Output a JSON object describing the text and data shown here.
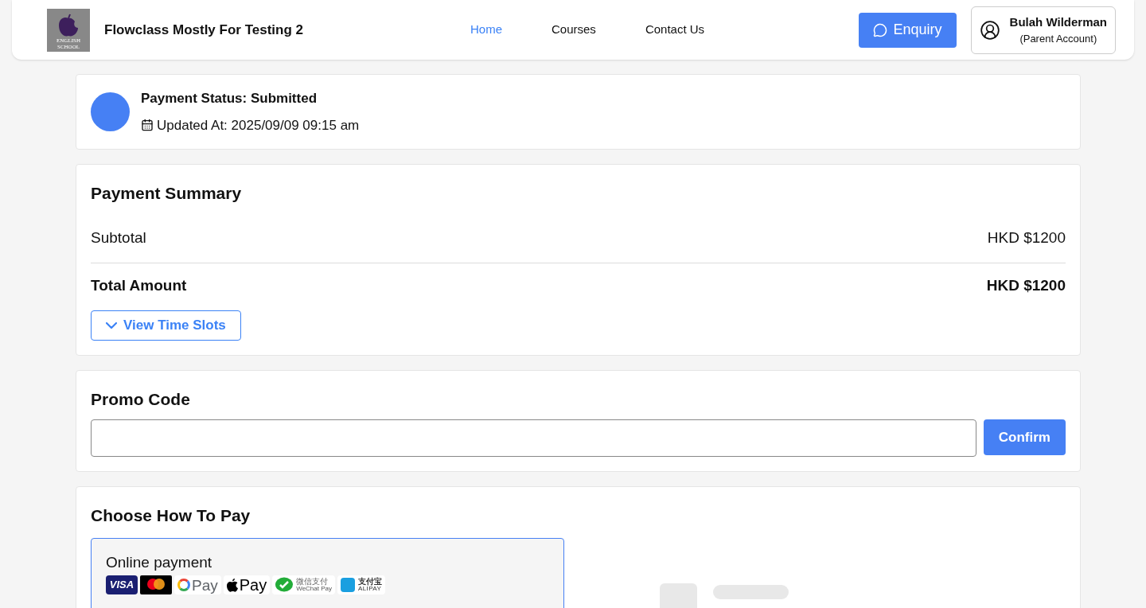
{
  "header": {
    "logo_lines": [
      "ENGLISH",
      "SCHOOL"
    ],
    "site_title": "Flowclass Mostly For Testing 2",
    "nav": [
      {
        "label": "Home",
        "selected": true
      },
      {
        "label": "Courses",
        "selected": false
      },
      {
        "label": "Contact Us",
        "selected": false
      }
    ],
    "enquiry_button": "Enquiry",
    "user": {
      "name": "Bulah Wilderman",
      "role": "(Parent Account)"
    }
  },
  "status": {
    "title": "Payment Status: Submitted",
    "updated": "Updated At: 2025/09/09 09:15 am",
    "color": "#4680f4"
  },
  "summary": {
    "title": "Payment Summary",
    "rows": [
      {
        "label": "Subtotal",
        "value": "HKD $1200",
        "kind": "normal"
      },
      {
        "label": "Total Amount",
        "value": "HKD $1200",
        "kind": "total"
      }
    ],
    "toggle": {
      "label": "View Time Slots",
      "expanded": false
    }
  },
  "promo": {
    "title": "Promo Code",
    "button": "Confirm"
  },
  "pay": {
    "title": "Choose How To Pay",
    "options": [
      {
        "label": "Online payment",
        "selected": true,
        "methods": [
          {
            "kind": "visa",
            "text": [
              "VISA"
            ]
          },
          {
            "kind": "mastercard"
          },
          {
            "kind": "gpay",
            "text": [
              "Pay"
            ]
          },
          {
            "kind": "applepay",
            "text": [
              "Pay"
            ]
          },
          {
            "kind": "wechat",
            "text": [
              "微信支付",
              "WeChat Pay"
            ]
          },
          {
            "kind": "alipay",
            "text": [
              "支付宝",
              "ALIPAY"
            ]
          }
        ]
      }
    ]
  }
}
